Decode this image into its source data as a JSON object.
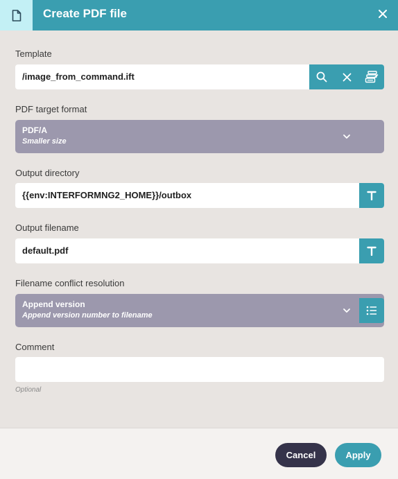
{
  "dialog": {
    "title": "Create PDF file",
    "header_icon": "document-icon",
    "close_icon": "close-icon"
  },
  "template": {
    "label": "Template",
    "value": "/image_from_command.ift",
    "buttons": [
      "search-icon",
      "clear-icon",
      "template-library-icon"
    ]
  },
  "pdf_format": {
    "label": "PDF target format",
    "selected": "PDF/A",
    "description": "Smaller size"
  },
  "output_directory": {
    "label": "Output directory",
    "value": "{{env:INTERFORMNG2_HOME}}/outbox",
    "button_icon": "text-type-icon"
  },
  "output_filename": {
    "label": "Output filename",
    "value": "default.pdf",
    "button_icon": "text-type-icon"
  },
  "conflict": {
    "label": "Filename conflict resolution",
    "selected": "Append version",
    "description": "Append version number to filename",
    "button_icon": "list-icon"
  },
  "comment": {
    "label": "Comment",
    "value": "",
    "hint": "Optional"
  },
  "footer": {
    "cancel_label": "Cancel",
    "apply_label": "Apply"
  },
  "colors": {
    "accent": "#3a9eb0",
    "select_bg": "#9c98ad",
    "cancel_bg": "#35334a",
    "body_bg": "#e8e4e1"
  }
}
